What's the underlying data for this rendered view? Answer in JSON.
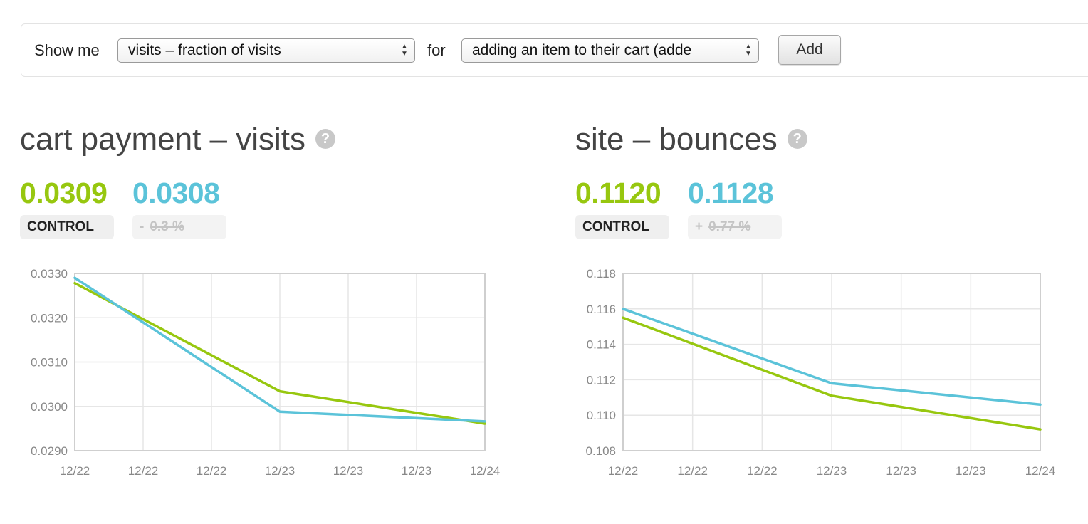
{
  "toolbar": {
    "show_me_label": "Show me",
    "metric_select_value": "visits – fraction of visits",
    "for_label": "for",
    "goal_select_value": "adding an item to their cart (adde",
    "add_button_label": "Add"
  },
  "colors": {
    "control": "#97c70f",
    "variant": "#5bc3d9",
    "grid": "#e6e6e6",
    "axis": "#cfcfcf"
  },
  "panels": [
    {
      "title": "cart payment – visits",
      "help_icon": "question-mark-icon",
      "control_value": "0.0309",
      "variant_value": "0.0308",
      "control_label": "CONTROL",
      "change_sign": "-",
      "change_value": "0.3 %"
    },
    {
      "title": "site – bounces",
      "help_icon": "question-mark-icon",
      "control_value": "0.1120",
      "variant_value": "0.1128",
      "control_label": "CONTROL",
      "change_sign": "+",
      "change_value": "0.77 %"
    }
  ],
  "chart_data": [
    {
      "type": "line",
      "x_tick_labels": [
        "12/22",
        "12/22",
        "12/22",
        "12/23",
        "12/23",
        "12/23",
        "12/24"
      ],
      "y_tick_labels": [
        "0.0330",
        "0.0320",
        "0.0310",
        "0.0300",
        "0.0290"
      ],
      "ylim": [
        0.029,
        0.033
      ],
      "grid": true,
      "x": [
        0,
        3,
        6
      ],
      "series": [
        {
          "color": "#97c70f",
          "values": [
            0.03278,
            0.03034,
            0.02961
          ]
        },
        {
          "color": "#5bc3d9",
          "values": [
            0.0329,
            0.02988,
            0.02966
          ]
        }
      ]
    },
    {
      "type": "line",
      "x_tick_labels": [
        "12/22",
        "12/22",
        "12/22",
        "12/23",
        "12/23",
        "12/23",
        "12/24"
      ],
      "y_tick_labels": [
        "0.118",
        "0.116",
        "0.114",
        "0.112",
        "0.110",
        "0.108"
      ],
      "ylim": [
        0.108,
        0.118
      ],
      "grid": true,
      "x": [
        0,
        3,
        6
      ],
      "series": [
        {
          "color": "#97c70f",
          "values": [
            0.1155,
            0.1111,
            0.1092
          ]
        },
        {
          "color": "#5bc3d9",
          "values": [
            0.116,
            0.1118,
            0.1106
          ]
        }
      ]
    }
  ]
}
